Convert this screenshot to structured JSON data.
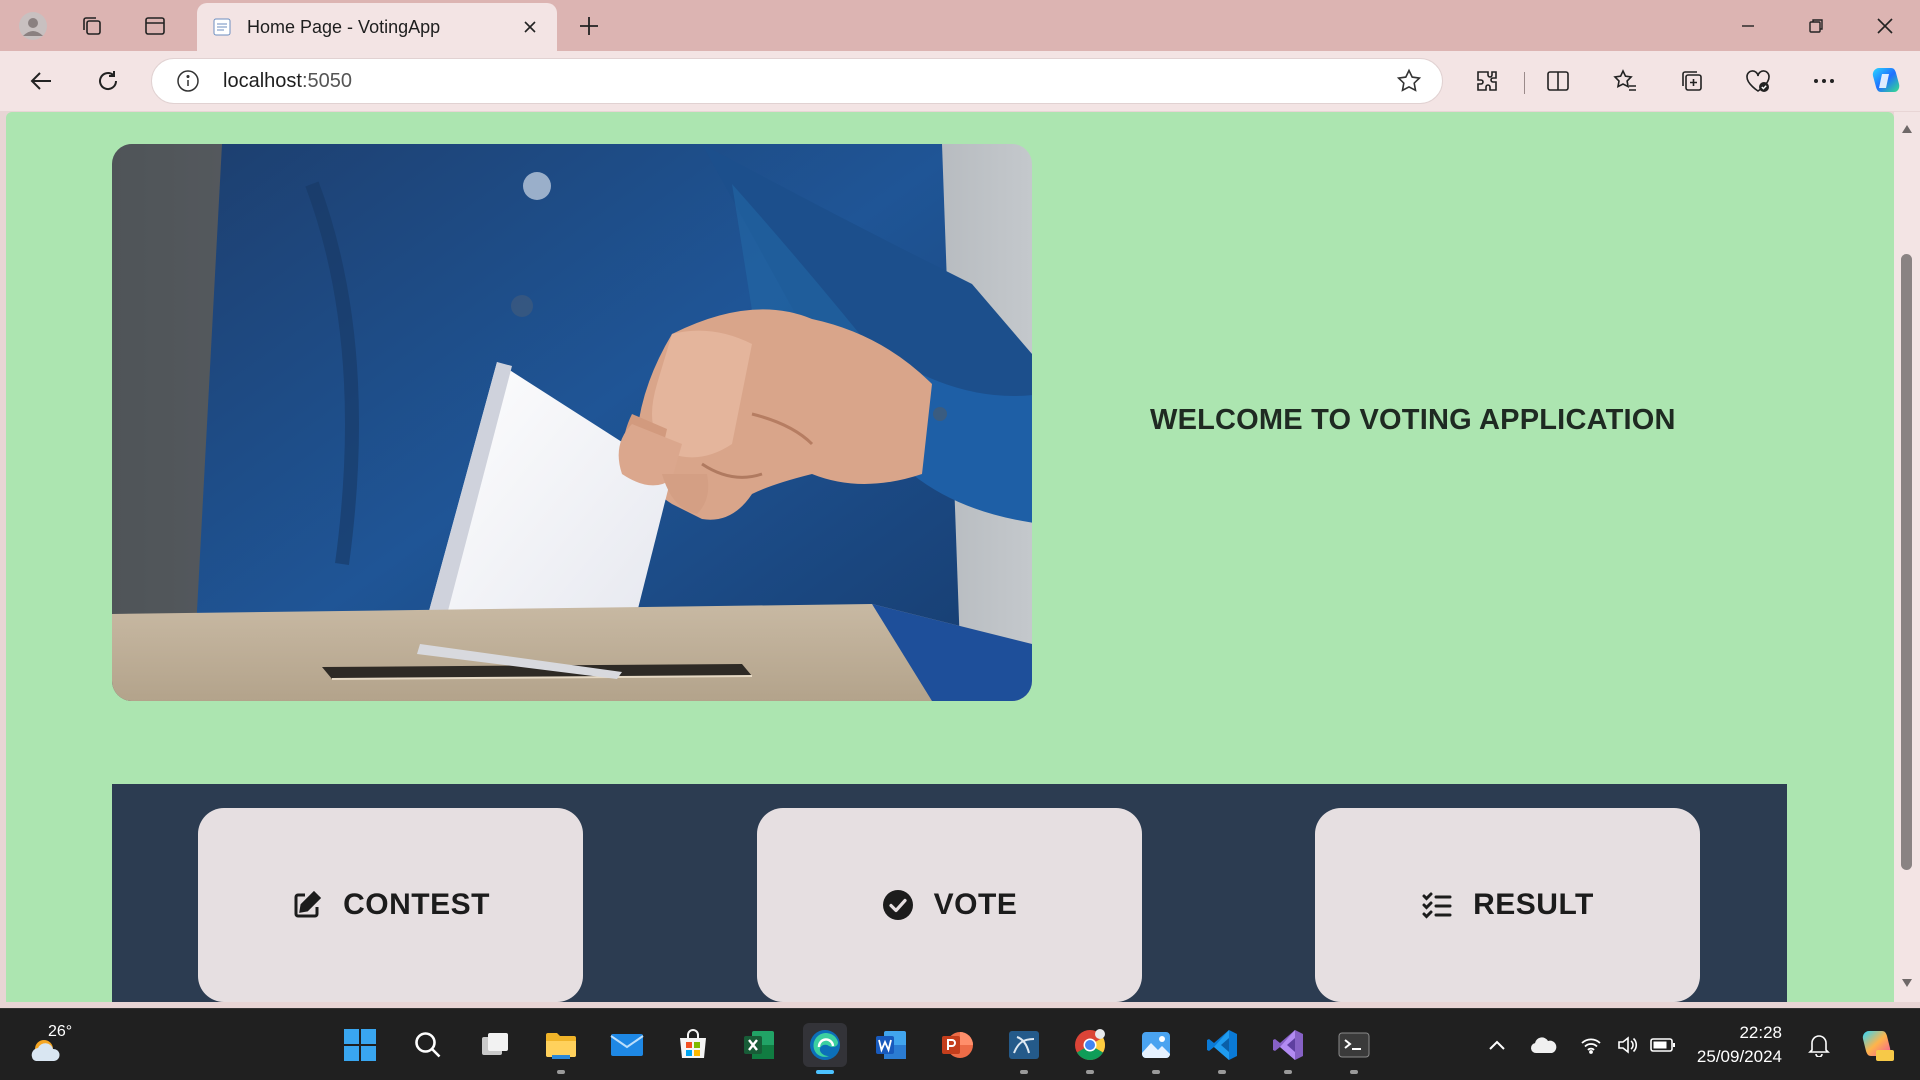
{
  "browser": {
    "tab": {
      "title": "Home Page - VotingApp"
    },
    "address": {
      "host": "localhost",
      "port": ":5050"
    }
  },
  "page": {
    "welcome": "WELCOME TO VOTING APPLICATION",
    "hero_image": "ballot-box-hand",
    "actions": [
      {
        "label": "CONTEST",
        "icon": "edit-icon"
      },
      {
        "label": "VOTE",
        "icon": "check-circle-icon"
      },
      {
        "label": "RESULT",
        "icon": "list-check-icon"
      }
    ]
  },
  "taskbar": {
    "weather": {
      "temp": "26°"
    },
    "clock": {
      "time": "22:28",
      "date": "25/09/2024"
    },
    "apps": [
      "start",
      "search",
      "task-view",
      "file-explorer",
      "mail",
      "microsoft-store",
      "excel",
      "edge",
      "word",
      "powerpoint",
      "mysql-workbench",
      "chrome",
      "photos",
      "vscode",
      "visual-studio",
      "terminal"
    ]
  },
  "colors": {
    "page_bg": "#ace5b0",
    "panel_bg": "#2c3c51",
    "card_bg": "#e6dfe1",
    "titlebar": "#dcb4b2"
  }
}
